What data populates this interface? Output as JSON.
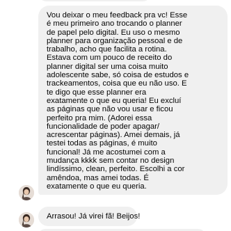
{
  "conversation": {
    "messages": [
      {
        "sender": "contact",
        "text": "Vou deixar o meu feedback pra vc! Esse\né meu primeiro ano trocando o planner\nde papel pelo digital. Eu uso o mesmo\nplanner para organização pessoal e de\ntrabalho, acho que facilita a rotina.\nEstava com um pouco de receito do\nplanner digital ser uma coisa muito\nadolescente sabe, só coisa de estudos e\ntrackeamentos, coisa que eu não uso. E\nte digo que esse planner era\nexatamente o que eu queria! Eu excluí\nas páginas que não vou usar e ficou\nperfeito pra mim. (Adorei essa\nfuncionalidade de poder apagar/\nacrescentar páginas). Amei demais, já\ntestei todas as páginas, é muito\nfuncional! Já me acostumei com a\nmudança kkkk sem contar no design\nlindíssimo, clean, perfeito. Escolhi a cor\namêndoa, mas amei todas. É\nexatamente o que eu queria."
      },
      {
        "sender": "contact",
        "text": "Arrasou! Já virei fã! Beijos!"
      }
    ]
  },
  "colors": {
    "bubble_background": "#f0f0f0",
    "text": "#050505",
    "page_background": "#ffffff"
  }
}
